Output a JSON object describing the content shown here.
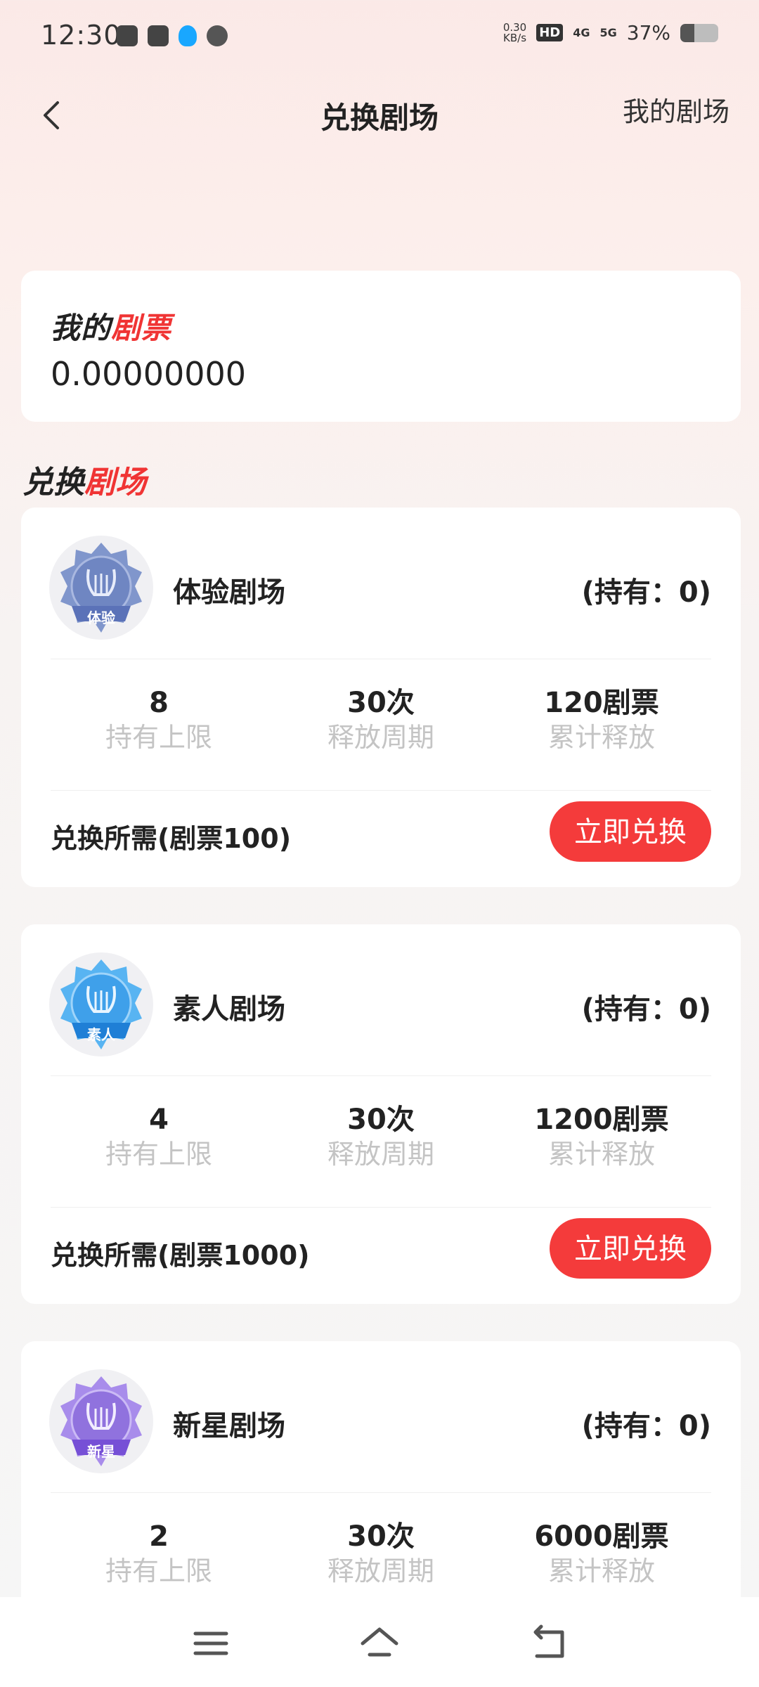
{
  "status_bar": {
    "time": "12:30",
    "net_speed_top": "0.30",
    "net_speed_bottom": "KB/s",
    "hd_badge": "HD",
    "signal_1": "4G",
    "signal_2": "5G",
    "battery_percent": "37%",
    "battery_level": 0.37
  },
  "nav": {
    "title": "兑换剧场",
    "right_link": "我的剧场"
  },
  "my_tickets": {
    "label_prefix": "我的",
    "label_accent": "剧票",
    "value": "0.00000000"
  },
  "section": {
    "title_prefix": "兑换",
    "title_accent": "剧场"
  },
  "theaters": [
    {
      "badge_text": "体验",
      "badge_color": "#7b90c9",
      "name": "体验剧场",
      "holding": "(持有：0)",
      "stats": [
        {
          "value": "8",
          "label": "持有上限"
        },
        {
          "value": "30次",
          "label": "释放周期"
        },
        {
          "value": "120剧票",
          "label": "累计释放"
        }
      ],
      "requirement": "兑换所需(剧票100)",
      "button": "立即兑换"
    },
    {
      "badge_text": "素人",
      "badge_color": "#4aa9f0",
      "name": "素人剧场",
      "holding": "(持有：0)",
      "stats": [
        {
          "value": "4",
          "label": "持有上限"
        },
        {
          "value": "30次",
          "label": "释放周期"
        },
        {
          "value": "1200剧票",
          "label": "累计释放"
        }
      ],
      "requirement": "兑换所需(剧票1000)",
      "button": "立即兑换"
    },
    {
      "badge_text": "新星",
      "badge_color": "#9a7be6",
      "name": "新星剧场",
      "holding": "(持有：0)",
      "stats": [
        {
          "value": "2",
          "label": "持有上限"
        },
        {
          "value": "30次",
          "label": "释放周期"
        },
        {
          "value": "6000剧票",
          "label": "累计释放"
        }
      ],
      "requirement": "",
      "button": ""
    }
  ],
  "colors": {
    "accent": "#f03434",
    "button": "#f43b3b"
  }
}
